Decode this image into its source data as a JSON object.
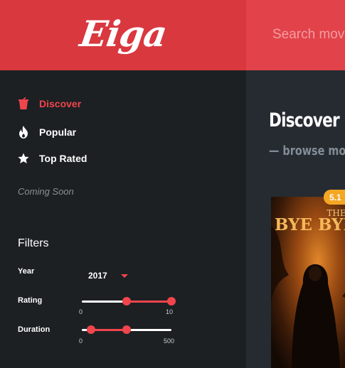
{
  "app": {
    "logo": "Eiga"
  },
  "search": {
    "placeholder": "Search movies"
  },
  "nav": {
    "items": [
      {
        "label": "Discover",
        "icon": "cup-icon",
        "active": true
      },
      {
        "label": "Popular",
        "icon": "flame-icon",
        "active": false
      },
      {
        "label": "Top Rated",
        "icon": "star-icon",
        "active": false
      }
    ],
    "coming_soon": "Coming Soon"
  },
  "filters": {
    "title": "Filters",
    "year": {
      "label": "Year",
      "value": "2017"
    },
    "rating": {
      "label": "Rating",
      "min_label": "0",
      "max_label": "10",
      "min": 0,
      "max": 10,
      "low": 5,
      "high": 10
    },
    "duration": {
      "label": "Duration",
      "min_label": "0",
      "max_label": "500",
      "min": 0,
      "max": 500,
      "low": 50,
      "high": 250
    }
  },
  "main": {
    "title": "Discover",
    "subtitle": "— browse mo",
    "movies": [
      {
        "rating": "5.1",
        "poster_title_top": "THE",
        "poster_title": "BYE BYE"
      }
    ]
  },
  "colors": {
    "accent": "#f0454c",
    "header_logo_bg": "#d9383f",
    "header_search_bg": "#e2434b",
    "sidebar_bg": "#1c2023",
    "main_bg": "#252b31",
    "badge": "#f5a623"
  }
}
